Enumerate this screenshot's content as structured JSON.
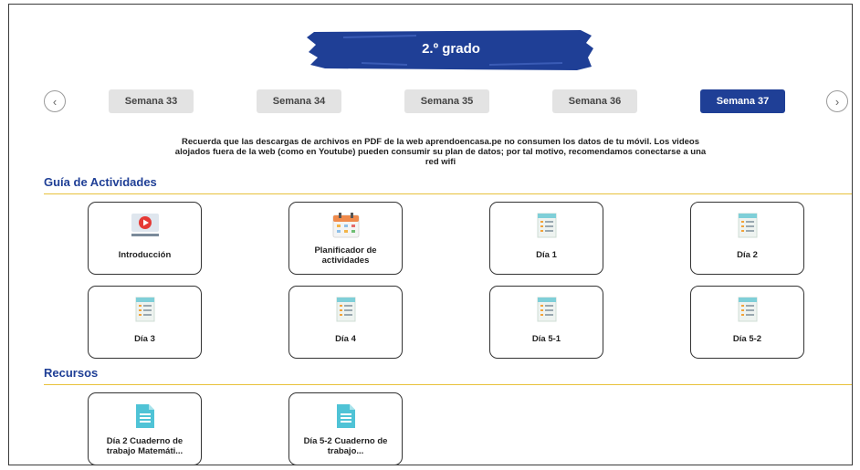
{
  "header": {
    "grade": "2.º grado"
  },
  "weeks": [
    {
      "label": "Semana 33"
    },
    {
      "label": "Semana 34"
    },
    {
      "label": "Semana 35"
    },
    {
      "label": "Semana 36"
    },
    {
      "label": "Semana 37",
      "active": true
    }
  ],
  "nav": {
    "prev": "‹",
    "next": "›"
  },
  "notice": "Recuerda que las descargas de archivos en PDF de la web aprendoencasa.pe no consumen los datos de tu móvil. Los videos alojados fuera de la web (como en Youtube) pueden consumir su plan de datos; por tal motivo, recomendamos conectarse a una red wifi",
  "guia": {
    "title": "Guía de Actividades",
    "cards": [
      {
        "label": "Introducción",
        "icon": "video-icon"
      },
      {
        "label": "Planificador de actividades",
        "icon": "calendar-icon"
      },
      {
        "label": "Día 1",
        "icon": "document-icon"
      },
      {
        "label": "Día 2",
        "icon": "document-icon"
      },
      {
        "label": "Día 3",
        "icon": "document-icon"
      },
      {
        "label": "Día 4",
        "icon": "document-icon"
      },
      {
        "label": "Día 5-1",
        "icon": "document-icon"
      },
      {
        "label": "Día 5-2",
        "icon": "document-icon"
      }
    ]
  },
  "recursos": {
    "title": "Recursos",
    "cards": [
      {
        "label": "Día 2 Cuaderno de trabajo Matemáti...",
        "icon": "file-icon"
      },
      {
        "label": "Día 5-2 Cuaderno de trabajo...",
        "icon": "file-icon"
      }
    ]
  },
  "colors": {
    "brand": "#1f3f96",
    "accent": "#e8c23c",
    "inactive_tab": "#e3e3e3"
  }
}
